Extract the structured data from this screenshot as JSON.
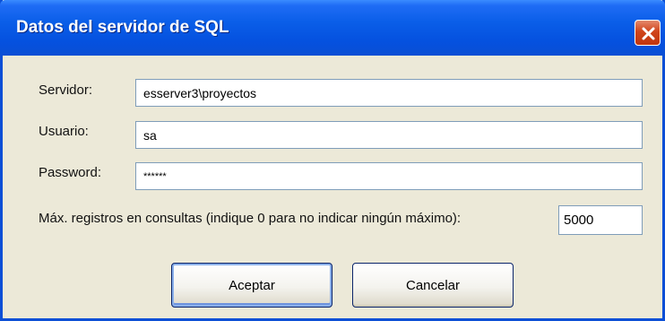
{
  "window": {
    "title": "Datos del servidor de SQL"
  },
  "form": {
    "servidor_label": "Servidor:",
    "servidor_value": "esserver3\\proyectos",
    "usuario_label": "Usuario:",
    "usuario_value": "sa",
    "password_label": "Password:",
    "password_masked": "******",
    "max_label": "Máx. registros en consultas (indique 0 para no indicar ningún máximo):",
    "max_value": "5000"
  },
  "buttons": {
    "accept_label": "Aceptar",
    "cancel_label": "Cancelar"
  },
  "colors": {
    "titlebar": "#0a5ee8",
    "dialog_bg": "#ece9d8",
    "close": "#c1360f",
    "field_border": "#7f9db9"
  }
}
